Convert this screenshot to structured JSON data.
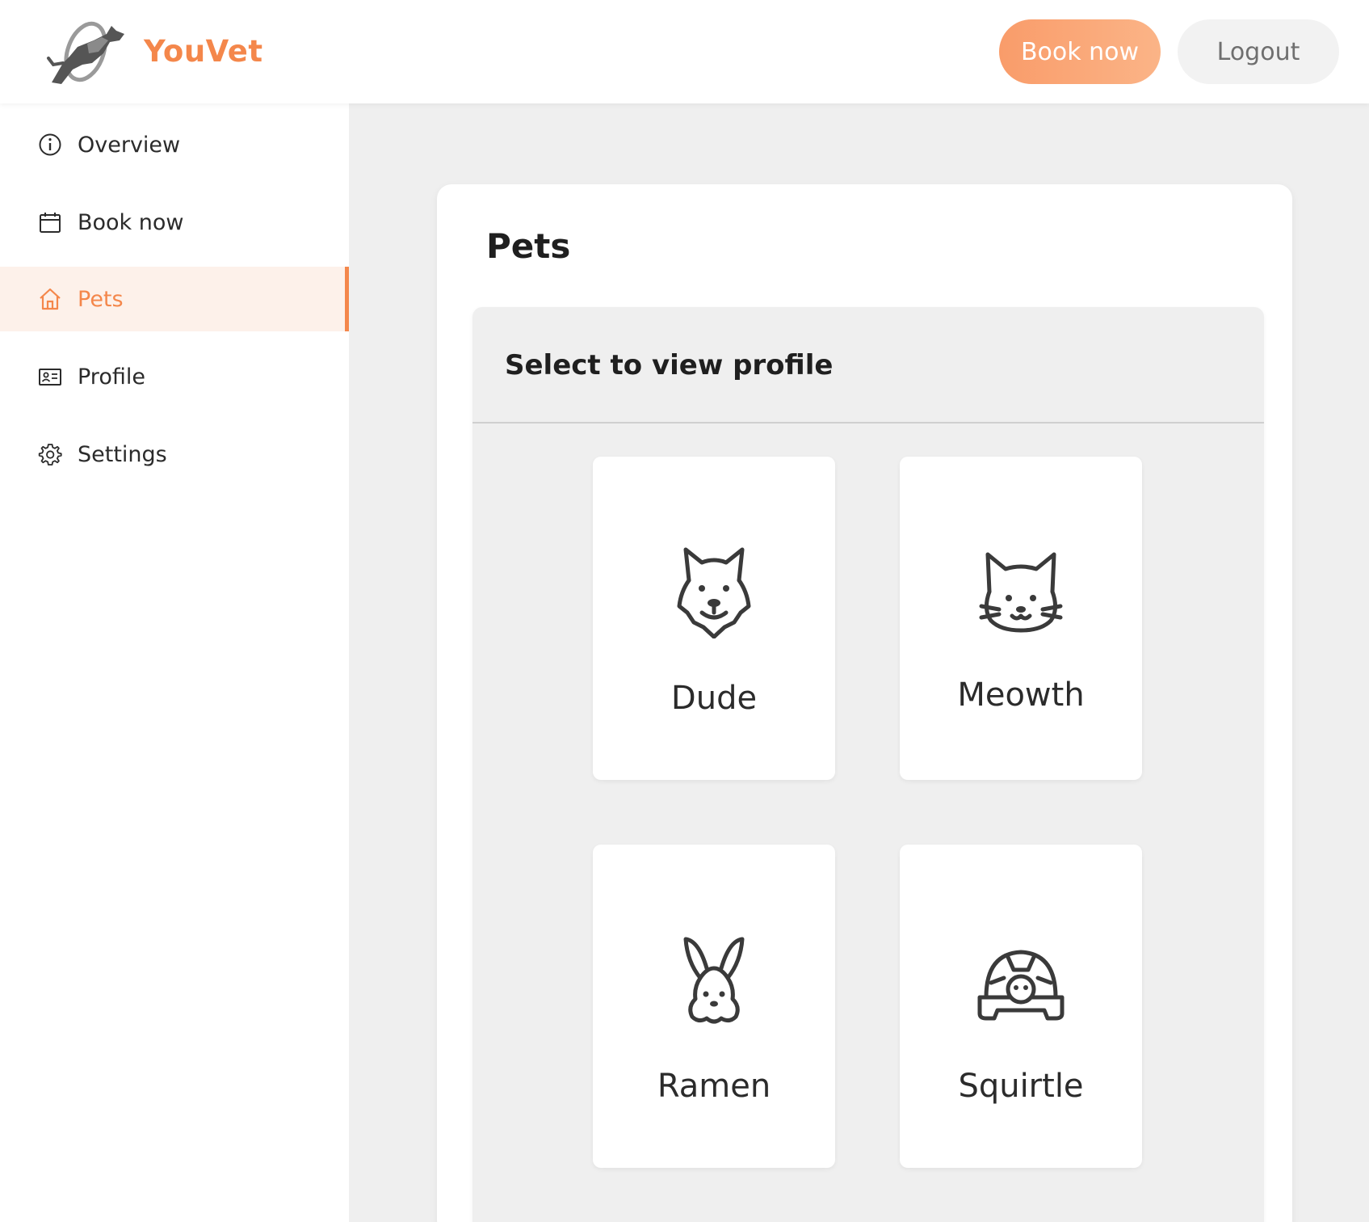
{
  "header": {
    "brand": "YouVet",
    "logo_icon": "dog-jumping-hoop-logo",
    "book_label": "Book now",
    "logout_label": "Logout",
    "accent_color": "#f4874b"
  },
  "sidebar": {
    "items": [
      {
        "label": "Overview",
        "icon": "info-icon",
        "active": false
      },
      {
        "label": "Book now",
        "icon": "calendar-icon",
        "active": false
      },
      {
        "label": "Pets",
        "icon": "home-icon",
        "active": true
      },
      {
        "label": "Profile",
        "icon": "id-card-icon",
        "active": false
      },
      {
        "label": "Settings",
        "icon": "gear-icon",
        "active": false
      }
    ]
  },
  "main": {
    "title": "Pets",
    "panel_title": "Select to view profile",
    "pets": [
      {
        "name": "Dude",
        "icon": "dog-icon"
      },
      {
        "name": "Meowth",
        "icon": "cat-icon"
      },
      {
        "name": "Ramen",
        "icon": "rabbit-icon"
      },
      {
        "name": "Squirtle",
        "icon": "turtle-icon"
      }
    ]
  }
}
